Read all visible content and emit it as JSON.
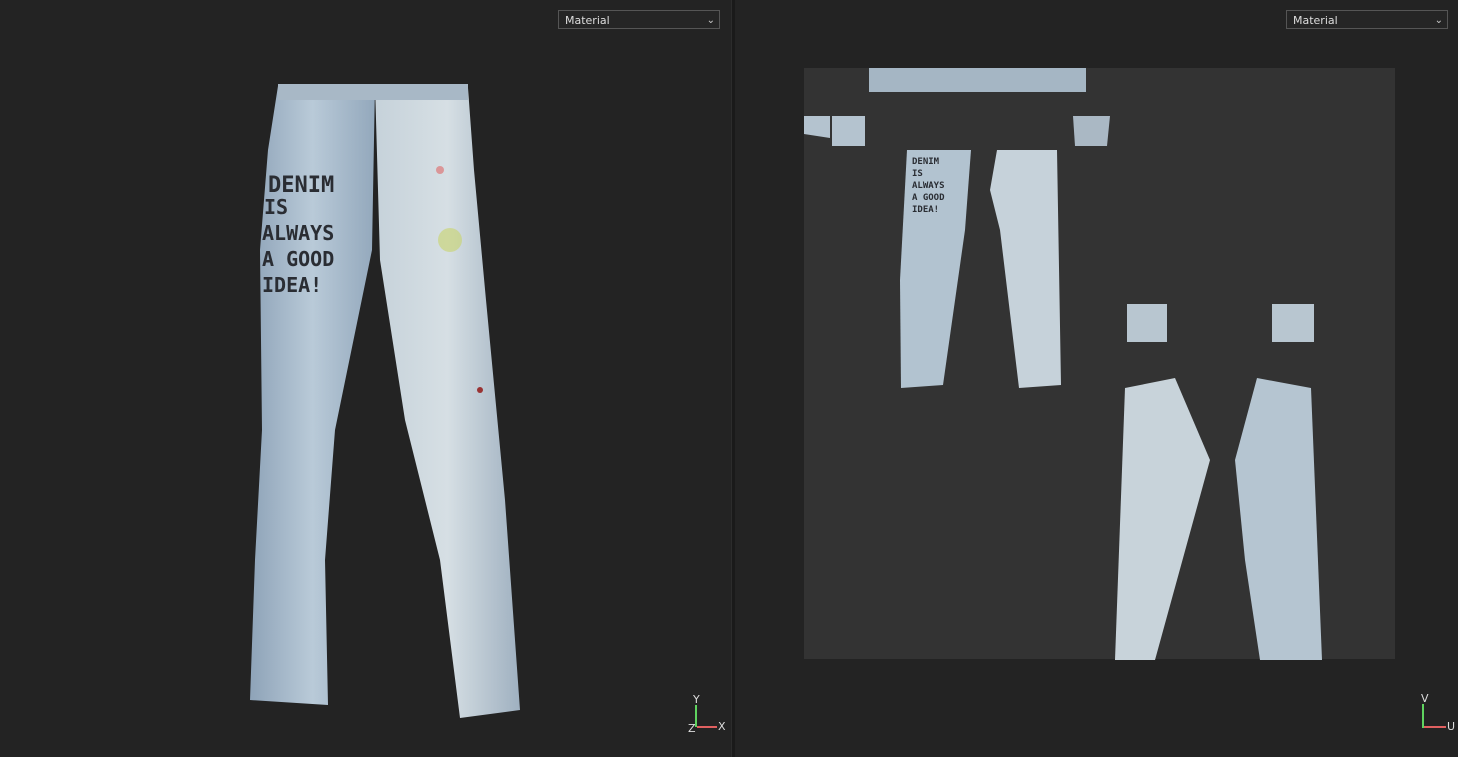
{
  "viewport_3d": {
    "shading_mode": "Material",
    "axes": {
      "x": "X",
      "y": "Y",
      "z": "Z"
    }
  },
  "viewport_uv": {
    "shading_mode": "Material",
    "axes": {
      "u": "U",
      "v": "V"
    }
  },
  "texture_text": [
    "DENIM",
    "IS",
    "ALWAYS",
    "A GOOD",
    "IDEA!"
  ],
  "colors": {
    "background": "#232323",
    "uv_canvas": "#333333",
    "axis_x": "#e06060",
    "axis_y": "#5fd35f",
    "denim": "#a9bccd"
  }
}
